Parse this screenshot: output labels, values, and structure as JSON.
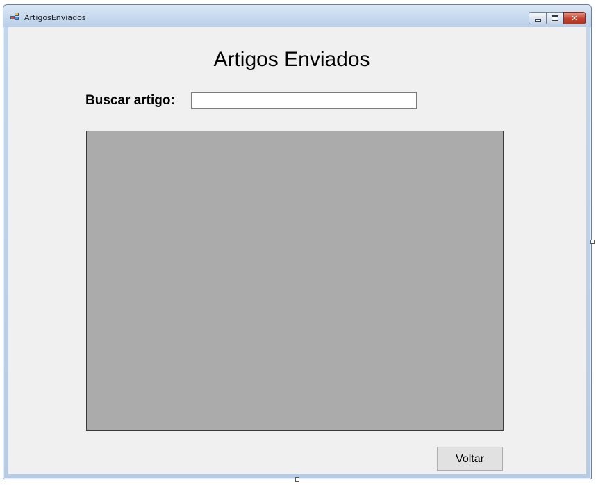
{
  "window": {
    "title": "ArtigosEnviados",
    "controls": {
      "minimize": "",
      "maximize": "",
      "close": "✕"
    }
  },
  "form": {
    "heading": "Artigos Enviados",
    "search_label": "Buscar artigo:",
    "search_value": "",
    "back_button": "Voltar"
  },
  "colors": {
    "client_background": "#f0f0f0",
    "grid_background": "#ababab",
    "button_background": "#e1e1e1"
  },
  "icons": [
    "application-icon",
    "minimize-icon",
    "maximize-icon",
    "close-icon"
  ]
}
